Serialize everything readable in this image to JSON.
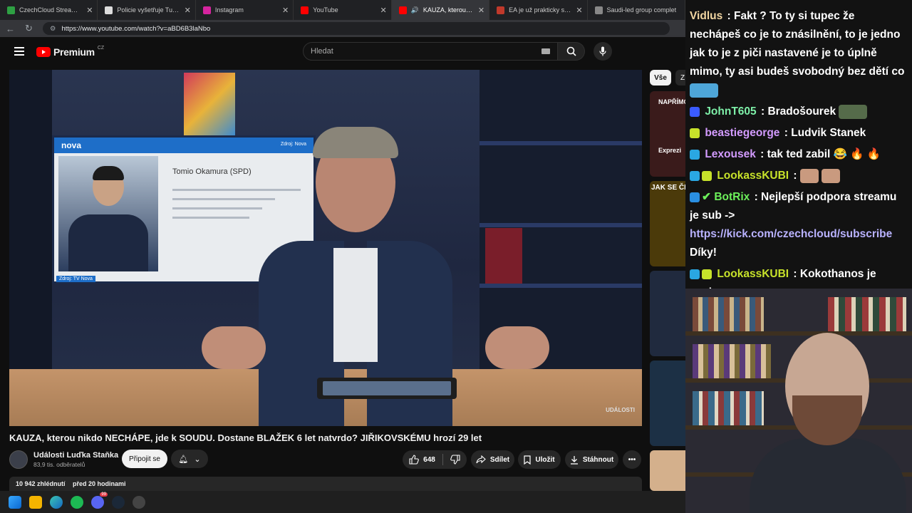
{
  "browser": {
    "tabs": [
      {
        "title": "CzechCloud Stream - Watch",
        "active": false,
        "favicon_color": "#2ea043"
      },
      {
        "title": "Policie vyšetřuje Turkovu neh",
        "active": false,
        "favicon_color": "#dddddd"
      },
      {
        "title": "Instagram",
        "active": false,
        "favicon_color": "#d6249f"
      },
      {
        "title": "YouTube",
        "active": false,
        "favicon_color": "#ff0000"
      },
      {
        "title": "KAUZA, kterou nikdo NEC",
        "active": true,
        "favicon_color": "#ff0000"
      },
      {
        "title": "EA je už prakticky saúdská. E",
        "active": false,
        "favicon_color": "#c0392b"
      },
      {
        "title": "Saudi-led group complet",
        "active": false,
        "favicon_color": "#888888"
      }
    ],
    "url": "https://www.youtube.com/watch?v=aBD6B3laNbo"
  },
  "youtube": {
    "logo_text": "Premium",
    "region": "CZ",
    "search_placeholder": "Hledat",
    "chip_all": "Vše",
    "chip_next": "Z"
  },
  "video": {
    "tv_logo": "nova",
    "tv_source_top": "Zdroj: Nova",
    "tv_person_name": "Tomio Okamura (SPD)",
    "tv_source_bottom": "Zdroj: TV Nova",
    "corner_logo": "UDÁLOSTI",
    "title": "KAUZA, kterou nikdo NECHÁPE, jde k SOUDU. Dostane BLAŽEK 6 let natvrdo? JIŘIKOVSKÉMU hrozí 29 let",
    "channel_name": "Události Luďka Staňka",
    "channel_subs": "83,9 tis. odběratelů",
    "join_label": "Připojit se",
    "like_count": "648",
    "share_label": "Sdílet",
    "save_label": "Uložit",
    "download_label": "Stáhnout",
    "views": "10 942 zhlédnutí",
    "uploaded": "před 20 hodinami"
  },
  "recommendations": [
    {
      "caption": "NAPŘÍMO",
      "bg": "#3a1b1b"
    },
    {
      "caption": "Exprezi",
      "bg": "#2a2a2a"
    },
    {
      "caption": "JAK SE ČES",
      "bg": "#4b3a0a"
    },
    {
      "caption": "",
      "bg": "#202a3e"
    },
    {
      "caption": "",
      "bg": "#1c3045"
    },
    {
      "caption": "",
      "bg": "#d4b08c"
    }
  ],
  "chat": [
    {
      "user": "Vidlus",
      "color": "#f2d6a2",
      "text": "Fakt ? To ty si tupec že nechápeš co je to znásilnění, to je jedno jak to je z piči nastavené je to úplně mimo, ty asi budeš svobodný bez dětí co",
      "emotes": 1
    },
    {
      "user": "JohnT605",
      "color": "#7ef0a8",
      "text": "Bradošourek",
      "emotes": 1,
      "badge": "#3a5bff"
    },
    {
      "user": "beastiegeorge",
      "color": "#d39bff",
      "text": "Ludvik Stanek",
      "emotes": 0,
      "badge": "#c7e22a"
    },
    {
      "user": "Lexousek",
      "color": "#d39bff",
      "text": "tak ted zabil 😂 🔥 🔥",
      "emotes": 0,
      "badge": "#2aa7e2"
    },
    {
      "user": "LookassKUBI",
      "color": "#c7e22a",
      "text": "",
      "emotes": 2,
      "badge": "#2aa7e2"
    },
    {
      "user": "BotRix",
      "color": "#6cf05a",
      "text": "Nejlepší podpora streamu je sub ->",
      "link": "https://kick.com/czechcloud/subscribe",
      "after_link": "Díky!",
      "emotes": 0,
      "badge": "#2a8fe2"
    },
    {
      "user": "LookassKUBI",
      "color": "#c7e22a",
      "text": "Kokothanos je pecka",
      "emotes": 3,
      "badge": "#2aa7e2"
    }
  ]
}
